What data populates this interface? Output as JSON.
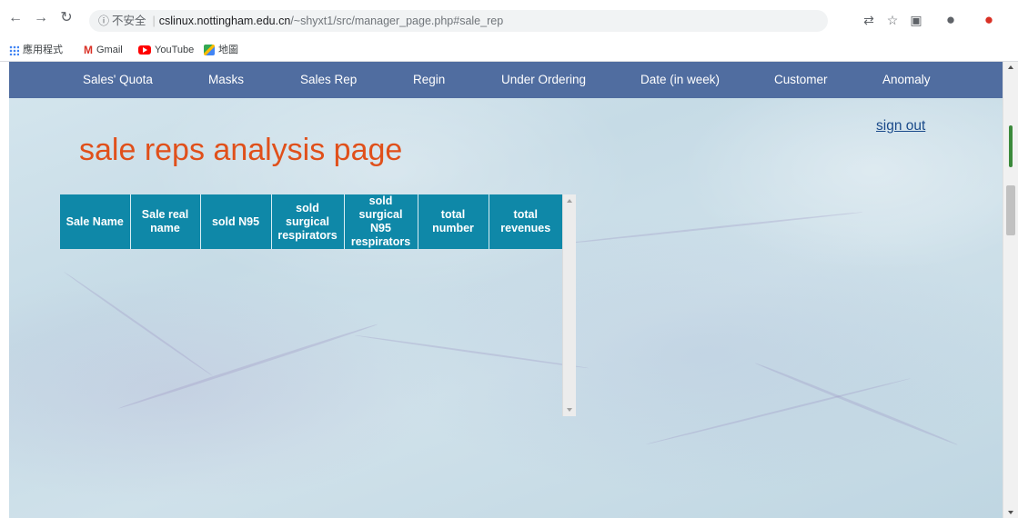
{
  "browser": {
    "security_label": "不安全",
    "url_host": "cslinux.nottingham.edu.cn",
    "url_path": "/~shyxt1/src/manager_page.php#sale_rep",
    "bookmarks": [
      {
        "label": "應用程式",
        "icon": "apps-grid-icon"
      },
      {
        "label": "Gmail",
        "icon": "gmail-icon"
      },
      {
        "label": "YouTube",
        "icon": "youtube-icon"
      },
      {
        "label": "地圖",
        "icon": "maps-icon"
      }
    ]
  },
  "nav": {
    "items": [
      {
        "label": "Sales' Quota"
      },
      {
        "label": "Masks"
      },
      {
        "label": "Sales Rep"
      },
      {
        "label": "Regin"
      },
      {
        "label": "Under Ordering"
      },
      {
        "label": "Date (in week)"
      },
      {
        "label": "Customer"
      },
      {
        "label": "Anomaly"
      }
    ]
  },
  "page": {
    "signout_label": "sign out",
    "title": "sale reps analysis page"
  },
  "table": {
    "headers": [
      [
        "Sale Name"
      ],
      [
        "Sale real",
        "name"
      ],
      [
        "sold N95"
      ],
      [
        "sold",
        "surgical",
        "respirators"
      ],
      [
        "sold",
        "surgical N95",
        "respirators"
      ],
      [
        "total",
        "number"
      ],
      [
        "total",
        "revenues"
      ]
    ],
    "rows": []
  },
  "colors": {
    "nav_bg": "#506da0",
    "table_header_bg": "#0f88a8",
    "title": "#e0501b",
    "link": "#1a4a8a"
  }
}
